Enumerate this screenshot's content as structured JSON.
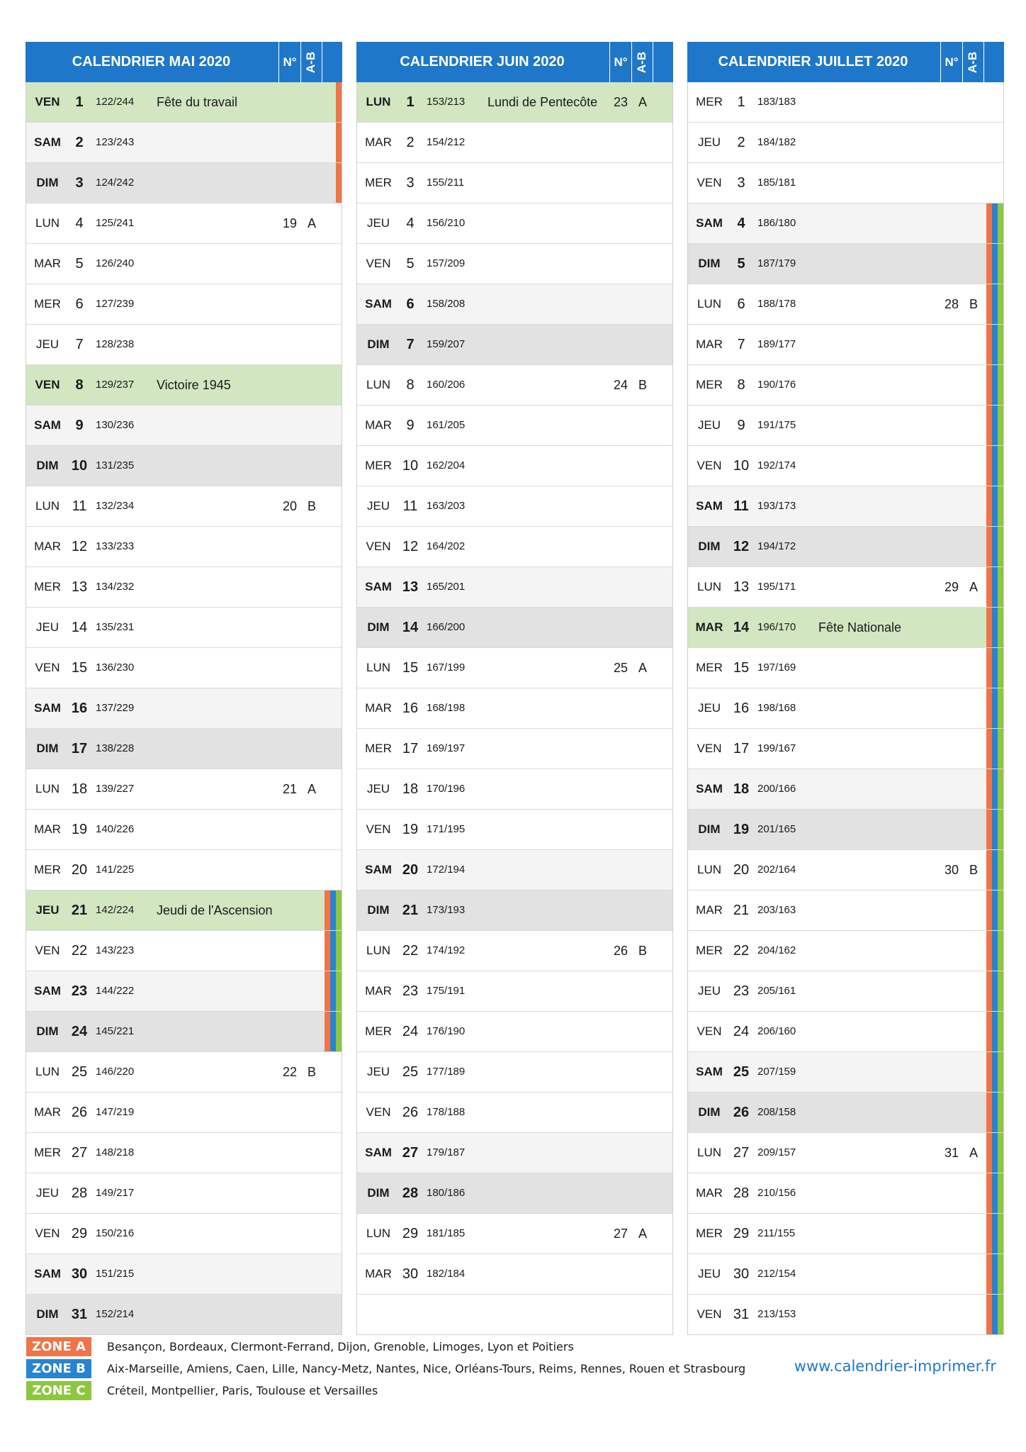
{
  "months": [
    {
      "title": "CALENDRIER MAI 2020",
      "col_no": "N°",
      "col_ab": "A-B",
      "days": [
        {
          "dow": "VEN",
          "num": "1",
          "doy": "122/244",
          "holiday": "Fête du travail",
          "type": "hol",
          "zones": [
            "A"
          ]
        },
        {
          "dow": "SAM",
          "num": "2",
          "doy": "123/243",
          "type": "sat",
          "zones": [
            "A"
          ]
        },
        {
          "dow": "DIM",
          "num": "3",
          "doy": "124/242",
          "type": "sun",
          "zones": [
            "A"
          ]
        },
        {
          "dow": "LUN",
          "num": "4",
          "doy": "125/241",
          "week": "19",
          "ab": "A"
        },
        {
          "dow": "MAR",
          "num": "5",
          "doy": "126/240"
        },
        {
          "dow": "MER",
          "num": "6",
          "doy": "127/239"
        },
        {
          "dow": "JEU",
          "num": "7",
          "doy": "128/238"
        },
        {
          "dow": "VEN",
          "num": "8",
          "doy": "129/237",
          "holiday": "Victoire 1945",
          "type": "hol"
        },
        {
          "dow": "SAM",
          "num": "9",
          "doy": "130/236",
          "type": "sat"
        },
        {
          "dow": "DIM",
          "num": "10",
          "doy": "131/235",
          "type": "sun"
        },
        {
          "dow": "LUN",
          "num": "11",
          "doy": "132/234",
          "week": "20",
          "ab": "B"
        },
        {
          "dow": "MAR",
          "num": "12",
          "doy": "133/233"
        },
        {
          "dow": "MER",
          "num": "13",
          "doy": "134/232"
        },
        {
          "dow": "JEU",
          "num": "14",
          "doy": "135/231"
        },
        {
          "dow": "VEN",
          "num": "15",
          "doy": "136/230"
        },
        {
          "dow": "SAM",
          "num": "16",
          "doy": "137/229",
          "type": "sat"
        },
        {
          "dow": "DIM",
          "num": "17",
          "doy": "138/228",
          "type": "sun"
        },
        {
          "dow": "LUN",
          "num": "18",
          "doy": "139/227",
          "week": "21",
          "ab": "A"
        },
        {
          "dow": "MAR",
          "num": "19",
          "doy": "140/226"
        },
        {
          "dow": "MER",
          "num": "20",
          "doy": "141/225"
        },
        {
          "dow": "JEU",
          "num": "21",
          "doy": "142/224",
          "holiday": "Jeudi de l'Ascension",
          "type": "hol",
          "zones": [
            "A",
            "B",
            "C"
          ]
        },
        {
          "dow": "VEN",
          "num": "22",
          "doy": "143/223",
          "zones": [
            "A",
            "B",
            "C"
          ]
        },
        {
          "dow": "SAM",
          "num": "23",
          "doy": "144/222",
          "type": "sat",
          "zones": [
            "A",
            "B",
            "C"
          ]
        },
        {
          "dow": "DIM",
          "num": "24",
          "doy": "145/221",
          "type": "sun",
          "zones": [
            "A",
            "B",
            "C"
          ]
        },
        {
          "dow": "LUN",
          "num": "25",
          "doy": "146/220",
          "week": "22",
          "ab": "B"
        },
        {
          "dow": "MAR",
          "num": "26",
          "doy": "147/219"
        },
        {
          "dow": "MER",
          "num": "27",
          "doy": "148/218"
        },
        {
          "dow": "JEU",
          "num": "28",
          "doy": "149/217"
        },
        {
          "dow": "VEN",
          "num": "29",
          "doy": "150/216"
        },
        {
          "dow": "SAM",
          "num": "30",
          "doy": "151/215",
          "type": "sat"
        },
        {
          "dow": "DIM",
          "num": "31",
          "doy": "152/214",
          "type": "sun"
        }
      ]
    },
    {
      "title": "CALENDRIER JUIN 2020",
      "col_no": "N°",
      "col_ab": "A-B",
      "days": [
        {
          "dow": "LUN",
          "num": "1",
          "doy": "153/213",
          "holiday": "Lundi de Pentecôte",
          "type": "hol",
          "week": "23",
          "ab": "A"
        },
        {
          "dow": "MAR",
          "num": "2",
          "doy": "154/212"
        },
        {
          "dow": "MER",
          "num": "3",
          "doy": "155/211"
        },
        {
          "dow": "JEU",
          "num": "4",
          "doy": "156/210"
        },
        {
          "dow": "VEN",
          "num": "5",
          "doy": "157/209"
        },
        {
          "dow": "SAM",
          "num": "6",
          "doy": "158/208",
          "type": "sat"
        },
        {
          "dow": "DIM",
          "num": "7",
          "doy": "159/207",
          "type": "sun"
        },
        {
          "dow": "LUN",
          "num": "8",
          "doy": "160/206",
          "week": "24",
          "ab": "B"
        },
        {
          "dow": "MAR",
          "num": "9",
          "doy": "161/205"
        },
        {
          "dow": "MER",
          "num": "10",
          "doy": "162/204"
        },
        {
          "dow": "JEU",
          "num": "11",
          "doy": "163/203"
        },
        {
          "dow": "VEN",
          "num": "12",
          "doy": "164/202"
        },
        {
          "dow": "SAM",
          "num": "13",
          "doy": "165/201",
          "type": "sat"
        },
        {
          "dow": "DIM",
          "num": "14",
          "doy": "166/200",
          "type": "sun"
        },
        {
          "dow": "LUN",
          "num": "15",
          "doy": "167/199",
          "week": "25",
          "ab": "A"
        },
        {
          "dow": "MAR",
          "num": "16",
          "doy": "168/198"
        },
        {
          "dow": "MER",
          "num": "17",
          "doy": "169/197"
        },
        {
          "dow": "JEU",
          "num": "18",
          "doy": "170/196"
        },
        {
          "dow": "VEN",
          "num": "19",
          "doy": "171/195"
        },
        {
          "dow": "SAM",
          "num": "20",
          "doy": "172/194",
          "type": "sat"
        },
        {
          "dow": "DIM",
          "num": "21",
          "doy": "173/193",
          "type": "sun"
        },
        {
          "dow": "LUN",
          "num": "22",
          "doy": "174/192",
          "week": "26",
          "ab": "B"
        },
        {
          "dow": "MAR",
          "num": "23",
          "doy": "175/191"
        },
        {
          "dow": "MER",
          "num": "24",
          "doy": "176/190"
        },
        {
          "dow": "JEU",
          "num": "25",
          "doy": "177/189"
        },
        {
          "dow": "VEN",
          "num": "26",
          "doy": "178/188"
        },
        {
          "dow": "SAM",
          "num": "27",
          "doy": "179/187",
          "type": "sat"
        },
        {
          "dow": "DIM",
          "num": "28",
          "doy": "180/186",
          "type": "sun"
        },
        {
          "dow": "LUN",
          "num": "29",
          "doy": "181/185",
          "week": "27",
          "ab": "A"
        },
        {
          "dow": "MAR",
          "num": "30",
          "doy": "182/184"
        },
        {
          "dow": "",
          "num": "",
          "doy": "",
          "type": "blank"
        }
      ]
    },
    {
      "title": "CALENDRIER JUILLET 2020",
      "col_no": "N°",
      "col_ab": "A-B",
      "days": [
        {
          "dow": "MER",
          "num": "1",
          "doy": "183/183"
        },
        {
          "dow": "JEU",
          "num": "2",
          "doy": "184/182"
        },
        {
          "dow": "VEN",
          "num": "3",
          "doy": "185/181"
        },
        {
          "dow": "SAM",
          "num": "4",
          "doy": "186/180",
          "type": "sat",
          "zones": [
            "A",
            "B",
            "C"
          ]
        },
        {
          "dow": "DIM",
          "num": "5",
          "doy": "187/179",
          "type": "sun",
          "zones": [
            "A",
            "B",
            "C"
          ]
        },
        {
          "dow": "LUN",
          "num": "6",
          "doy": "188/178",
          "week": "28",
          "ab": "B",
          "zones": [
            "A",
            "B",
            "C"
          ]
        },
        {
          "dow": "MAR",
          "num": "7",
          "doy": "189/177",
          "zones": [
            "A",
            "B",
            "C"
          ]
        },
        {
          "dow": "MER",
          "num": "8",
          "doy": "190/176",
          "zones": [
            "A",
            "B",
            "C"
          ]
        },
        {
          "dow": "JEU",
          "num": "9",
          "doy": "191/175",
          "zones": [
            "A",
            "B",
            "C"
          ]
        },
        {
          "dow": "VEN",
          "num": "10",
          "doy": "192/174",
          "zones": [
            "A",
            "B",
            "C"
          ]
        },
        {
          "dow": "SAM",
          "num": "11",
          "doy": "193/173",
          "type": "sat",
          "zones": [
            "A",
            "B",
            "C"
          ]
        },
        {
          "dow": "DIM",
          "num": "12",
          "doy": "194/172",
          "type": "sun",
          "zones": [
            "A",
            "B",
            "C"
          ]
        },
        {
          "dow": "LUN",
          "num": "13",
          "doy": "195/171",
          "week": "29",
          "ab": "A",
          "zones": [
            "A",
            "B",
            "C"
          ]
        },
        {
          "dow": "MAR",
          "num": "14",
          "doy": "196/170",
          "holiday": "Fête Nationale",
          "type": "hol",
          "zones": [
            "A",
            "B",
            "C"
          ]
        },
        {
          "dow": "MER",
          "num": "15",
          "doy": "197/169",
          "zones": [
            "A",
            "B",
            "C"
          ]
        },
        {
          "dow": "JEU",
          "num": "16",
          "doy": "198/168",
          "zones": [
            "A",
            "B",
            "C"
          ]
        },
        {
          "dow": "VEN",
          "num": "17",
          "doy": "199/167",
          "zones": [
            "A",
            "B",
            "C"
          ]
        },
        {
          "dow": "SAM",
          "num": "18",
          "doy": "200/166",
          "type": "sat",
          "zones": [
            "A",
            "B",
            "C"
          ]
        },
        {
          "dow": "DIM",
          "num": "19",
          "doy": "201/165",
          "type": "sun",
          "zones": [
            "A",
            "B",
            "C"
          ]
        },
        {
          "dow": "LUN",
          "num": "20",
          "doy": "202/164",
          "week": "30",
          "ab": "B",
          "zones": [
            "A",
            "B",
            "C"
          ]
        },
        {
          "dow": "MAR",
          "num": "21",
          "doy": "203/163",
          "zones": [
            "A",
            "B",
            "C"
          ]
        },
        {
          "dow": "MER",
          "num": "22",
          "doy": "204/162",
          "zones": [
            "A",
            "B",
            "C"
          ]
        },
        {
          "dow": "JEU",
          "num": "23",
          "doy": "205/161",
          "zones": [
            "A",
            "B",
            "C"
          ]
        },
        {
          "dow": "VEN",
          "num": "24",
          "doy": "206/160",
          "zones": [
            "A",
            "B",
            "C"
          ]
        },
        {
          "dow": "SAM",
          "num": "25",
          "doy": "207/159",
          "type": "sat",
          "zones": [
            "A",
            "B",
            "C"
          ]
        },
        {
          "dow": "DIM",
          "num": "26",
          "doy": "208/158",
          "type": "sun",
          "zones": [
            "A",
            "B",
            "C"
          ]
        },
        {
          "dow": "LUN",
          "num": "27",
          "doy": "209/157",
          "week": "31",
          "ab": "A",
          "zones": [
            "A",
            "B",
            "C"
          ]
        },
        {
          "dow": "MAR",
          "num": "28",
          "doy": "210/156",
          "zones": [
            "A",
            "B",
            "C"
          ]
        },
        {
          "dow": "MER",
          "num": "29",
          "doy": "211/155",
          "zones": [
            "A",
            "B",
            "C"
          ]
        },
        {
          "dow": "JEU",
          "num": "30",
          "doy": "212/154",
          "zones": [
            "A",
            "B",
            "C"
          ]
        },
        {
          "dow": "VEN",
          "num": "31",
          "doy": "213/153",
          "zones": [
            "A",
            "B",
            "C"
          ]
        }
      ]
    }
  ],
  "legend": [
    {
      "label": "ZONE A",
      "zone": "A",
      "color": "#ef7447",
      "cities": "Besançon, Bordeaux, Clermont-Ferrand, Dijon, Grenoble, Limoges, Lyon et Poitiers"
    },
    {
      "label": "ZONE B",
      "zone": "B",
      "color": "#2884d1",
      "cities": "Aix-Marseille, Amiens, Caen, Lille, Nancy-Metz, Nantes, Nice, Orléans-Tours, Reims, Rennes, Rouen et Strasbourg"
    },
    {
      "label": "ZONE C",
      "zone": "C",
      "color": "#8ec63f",
      "cities": "Créteil, Montpellier, Paris, Toulouse et Versailles"
    }
  ],
  "website": "www.calendrier-imprimer.fr"
}
